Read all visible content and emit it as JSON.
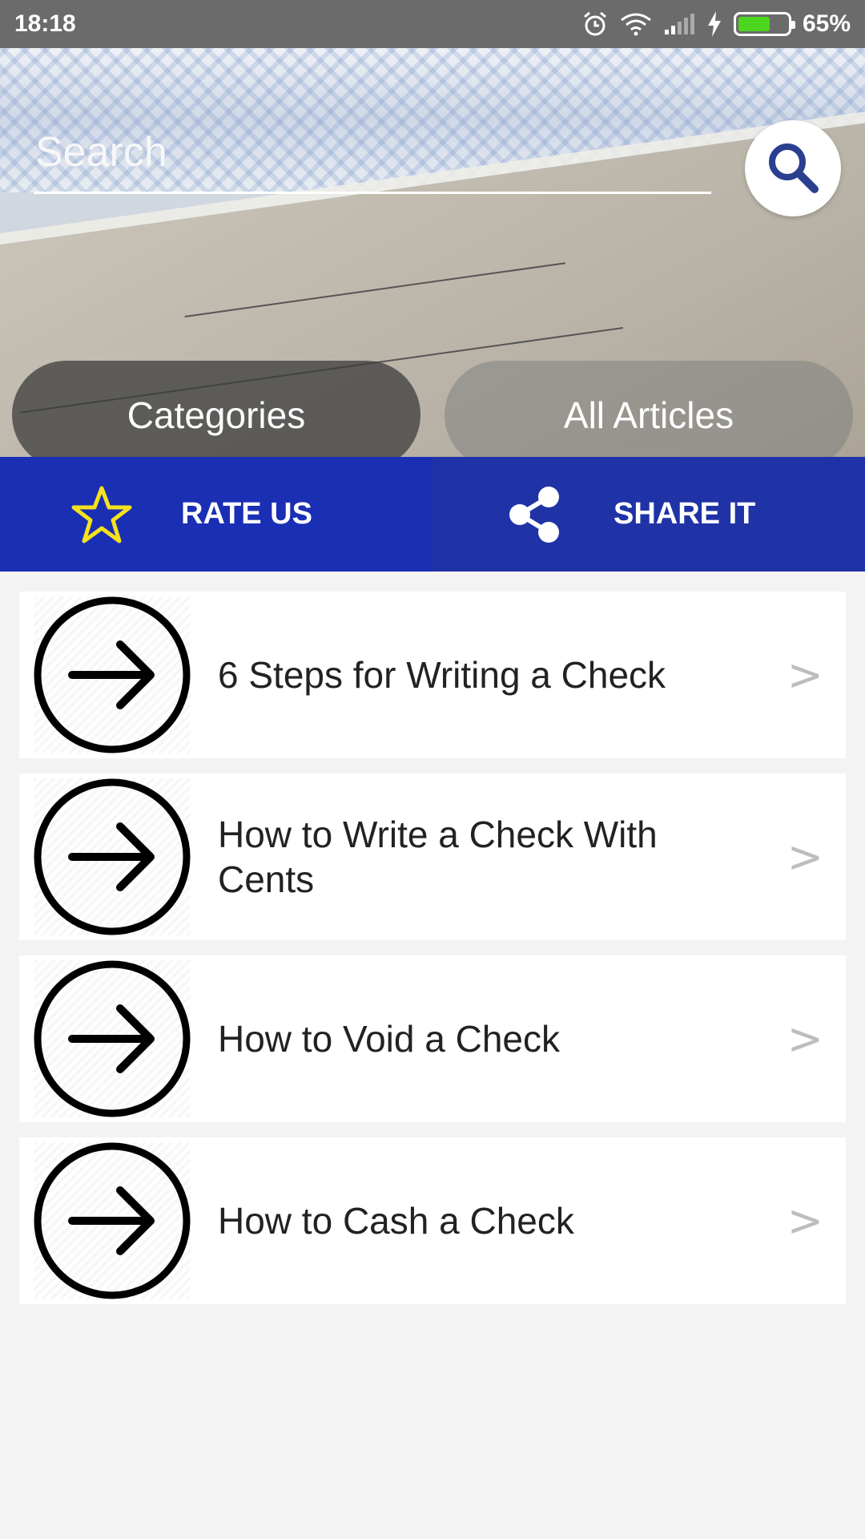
{
  "status_bar": {
    "time": "18:18",
    "battery_percent": "65%",
    "battery_level": 0.65
  },
  "search": {
    "placeholder": "Search"
  },
  "hero": {
    "categories_label": "Categories",
    "all_articles_label": "All Articles"
  },
  "actions": {
    "rate_label": "RATE US",
    "share_label": "SHARE IT"
  },
  "articles": [
    {
      "title": "6 Steps for Writing a Check",
      "chevron": ">"
    },
    {
      "title": "How to Write a Check With Cents",
      "chevron": ">"
    },
    {
      "title": "How to Void a Check",
      "chevron": ">"
    },
    {
      "title": "How to Cash a Check",
      "chevron": ">"
    }
  ],
  "colors": {
    "status_bar": "#6b6b6b",
    "rate_bg": "#1a2fb4",
    "share_bg": "#1f33a6",
    "star": "#f5e21c",
    "search_icon": "#2a3f8f",
    "battery": "#4cd620"
  },
  "icons": {
    "search": "search-icon",
    "star": "star-icon",
    "share": "share-icon",
    "arrow": "arrow-circle-icon",
    "alarm": "alarm-icon",
    "wifi": "wifi-icon",
    "signal": "signal-icon",
    "charging": "charging-icon"
  }
}
